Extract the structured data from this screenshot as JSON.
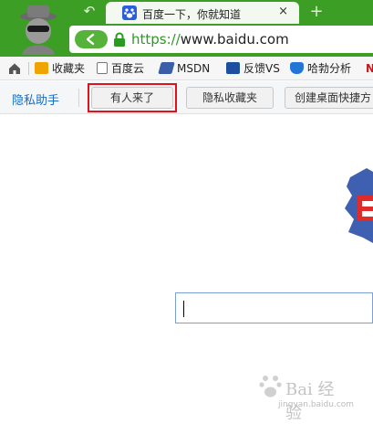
{
  "browser": {
    "tab": {
      "title": "百度一下，你就知道",
      "close_glyph": "×"
    },
    "new_tab_glyph": "+",
    "back_tab_glyph": "↶",
    "url_scheme": "https://",
    "url_host": "www.baidu.com",
    "accent_color": "#3c9e25"
  },
  "bookmarks": {
    "items": [
      {
        "label": "收藏夹",
        "icon": "folder-icon"
      },
      {
        "label": "百度云",
        "icon": "page-icon"
      },
      {
        "label": "MSDN",
        "icon": "msdn-icon"
      },
      {
        "label": "反馈VS",
        "icon": "vs-feedback-icon"
      },
      {
        "label": "哈勃分析",
        "icon": "shield-icon"
      }
    ]
  },
  "privacy_toolbar": {
    "title": "隐私助手",
    "buttons": [
      {
        "label": "有人来了",
        "highlighted": true
      },
      {
        "label": "隐私收藏夹"
      },
      {
        "label": "创建桌面快捷方"
      }
    ],
    "highlight_color": "#e0131c"
  },
  "watermark": {
    "text": "Bai 经验",
    "sub": "jingyan.baidu.com"
  }
}
